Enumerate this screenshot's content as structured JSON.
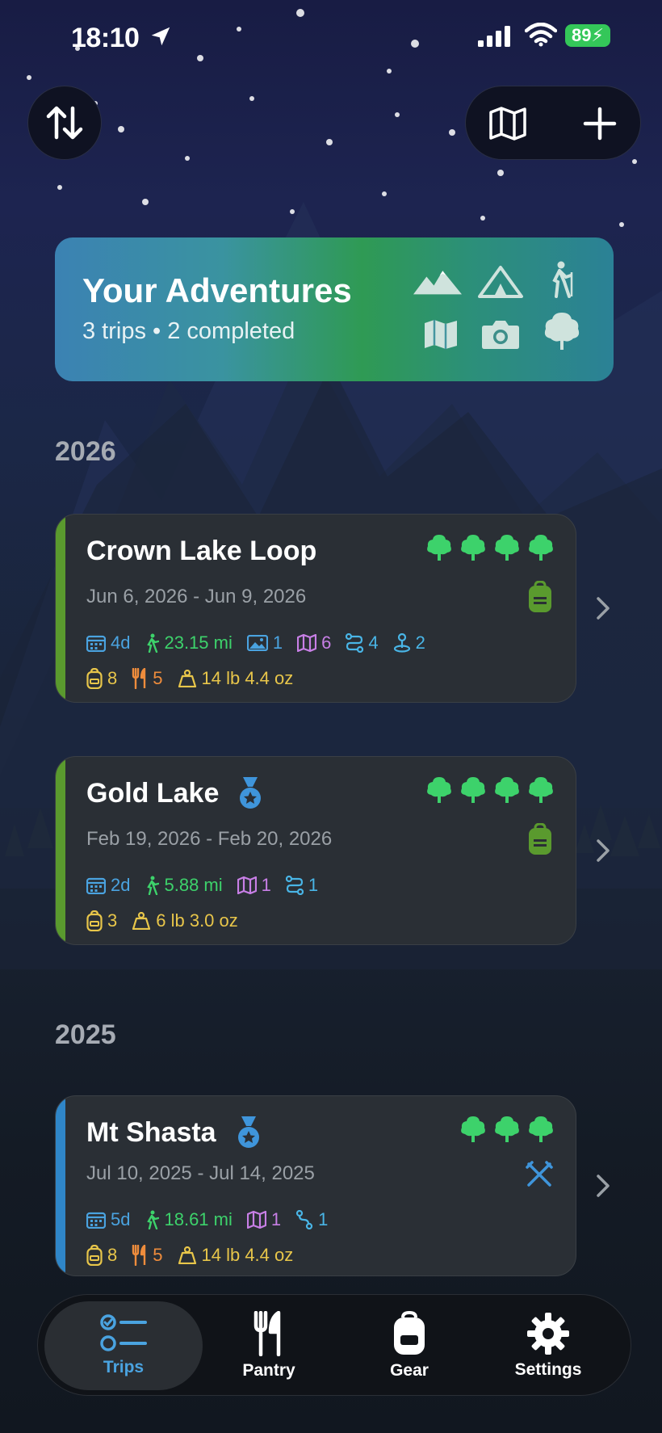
{
  "status_bar": {
    "time": "18:10",
    "battery": "89"
  },
  "header": {
    "sort_icon": "sort-icon",
    "map_icon": "map-icon",
    "add_icon": "plus-icon"
  },
  "hero": {
    "title": "Your Adventures",
    "subtitle": "3 trips • 2 completed",
    "icons": [
      "mountains-icon",
      "tent-icon",
      "hiker-icon",
      "map-icon",
      "camera-icon",
      "tree-icon"
    ]
  },
  "sections": [
    {
      "year": "2026",
      "trips": [
        {
          "name": "Crown Lake Loop",
          "dates": "Jun 6, 2026 - Jun 9, 2026",
          "trees": 4,
          "medal": false,
          "accent": "#5a9a2e",
          "activity_icon": "backpack-icon",
          "stats_row1": [
            {
              "icon": "calendar-icon",
              "value": "4d",
              "color": "#4aa3e0"
            },
            {
              "icon": "hiker-icon",
              "value": "23.15 mi",
              "color": "#3dd26b"
            },
            {
              "icon": "photo-icon",
              "value": "1",
              "color": "#4aa3e0"
            },
            {
              "icon": "map-icon",
              "value": "6",
              "color": "#c87fe6"
            },
            {
              "icon": "route-icon",
              "value": "4",
              "color": "#49b5e6"
            },
            {
              "icon": "pin-icon",
              "value": "2",
              "color": "#49b5e6"
            }
          ],
          "stats_row2": [
            {
              "icon": "backpack-icon",
              "value": "8",
              "color": "#e8c64a"
            },
            {
              "icon": "utensils-icon",
              "value": "5",
              "color": "#ee8c3c"
            },
            {
              "icon": "weight-icon",
              "value": "14 lb 4.4 oz",
              "color": "#e8c64a"
            }
          ]
        },
        {
          "name": "Gold Lake",
          "dates": "Feb 19, 2026 - Feb 20, 2026",
          "trees": 4,
          "medal": true,
          "accent": "#5a9a2e",
          "activity_icon": "backpack-icon",
          "stats_row1": [
            {
              "icon": "calendar-icon",
              "value": "2d",
              "color": "#4aa3e0"
            },
            {
              "icon": "hiker-icon",
              "value": "5.88 mi",
              "color": "#3dd26b"
            },
            {
              "icon": "map-icon",
              "value": "1",
              "color": "#c87fe6"
            },
            {
              "icon": "route-icon",
              "value": "1",
              "color": "#49b5e6"
            }
          ],
          "stats_row2": [
            {
              "icon": "backpack-icon",
              "value": "3",
              "color": "#e8c64a"
            },
            {
              "icon": "weight-icon",
              "value": "6 lb 3.0 oz",
              "color": "#e8c64a"
            }
          ]
        }
      ]
    },
    {
      "year": "2025",
      "trips": [
        {
          "name": "Mt Shasta",
          "dates": "Jul 10, 2025 - Jul 14, 2025",
          "trees": 3,
          "medal": true,
          "accent": "#2f86c8",
          "activity_icon": "ice-axes-icon",
          "stats_row1": [
            {
              "icon": "calendar-icon",
              "value": "5d",
              "color": "#4aa3e0"
            },
            {
              "icon": "hiker-icon",
              "value": "18.61 mi",
              "color": "#3dd26b"
            },
            {
              "icon": "map-icon",
              "value": "1",
              "color": "#c87fe6"
            },
            {
              "icon": "route-icon",
              "value": "1",
              "color": "#49b5e6"
            }
          ],
          "stats_row2": [
            {
              "icon": "backpack-icon",
              "value": "8",
              "color": "#e8c64a"
            },
            {
              "icon": "utensils-icon",
              "value": "5",
              "color": "#ee8c3c"
            },
            {
              "icon": "weight-icon",
              "value": "14 lb 4.4 oz",
              "color": "#e8c64a"
            }
          ]
        }
      ]
    }
  ],
  "tabs": [
    {
      "label": "Trips",
      "icon": "checklist-icon",
      "active": true
    },
    {
      "label": "Pantry",
      "icon": "utensils-icon",
      "active": false
    },
    {
      "label": "Gear",
      "icon": "backpack-icon",
      "active": false
    },
    {
      "label": "Settings",
      "icon": "gear-icon",
      "active": false
    }
  ]
}
